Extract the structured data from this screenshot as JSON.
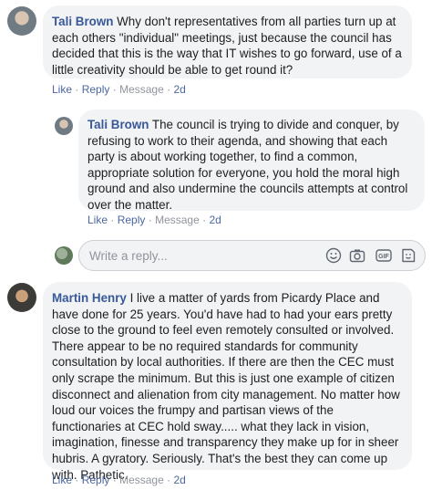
{
  "comments": [
    {
      "author": "Tali Brown",
      "text": " Why don't representatives from all parties turn up at each others \"individual\" meetings, just because the council has decided that this is the way that IT wishes to go forward, use of a little creativity should be able to get round it?",
      "actions": {
        "like": "Like",
        "reply": "Reply",
        "message": "Message",
        "time": "2d"
      }
    },
    {
      "author": "Tali Brown",
      "text": " The council is trying to divide and conquer, by refusing to work to their agenda, and showing that each party is about working together, to find a common, appropriate solution for everyone, you hold the moral high ground and also undermine the councils attempts at control over the matter.",
      "actions": {
        "like": "Like",
        "reply": "Reply",
        "message": "Message",
        "time": "2d"
      }
    },
    {
      "author": "Martin Henry",
      "text": " I live a matter of yards from Picardy Place and have done for 25 years. You'd have had to had your ears pretty close to the ground to feel even remotely consulted or involved. There appear to be no required standards for community consultation by local authorities. If there are then the CEC must only scrape the minimum. But this is just one example of citizen disconnect and alienation from city management. No matter how loud our voices the frumpy and partisan views of the functionaries at CEC hold sway..... what they lack in vision, imagination, finesse and transparency they make up for in sheer hubris. A gyratory. Seriously. That's the best they can come up with. Pathetic.",
      "actions": {
        "like": "Like",
        "reply": "Reply",
        "message": "Message",
        "time": "2d"
      }
    }
  ],
  "reply_box": {
    "placeholder": "Write a reply...",
    "icons": [
      "emoji-icon",
      "camera-icon",
      "gif-icon",
      "sticker-icon"
    ]
  },
  "separator": "·",
  "colors": {
    "author": "#385898",
    "link": "#4b67a1",
    "muted": "#90949c",
    "bubble": "#f2f3f5"
  }
}
